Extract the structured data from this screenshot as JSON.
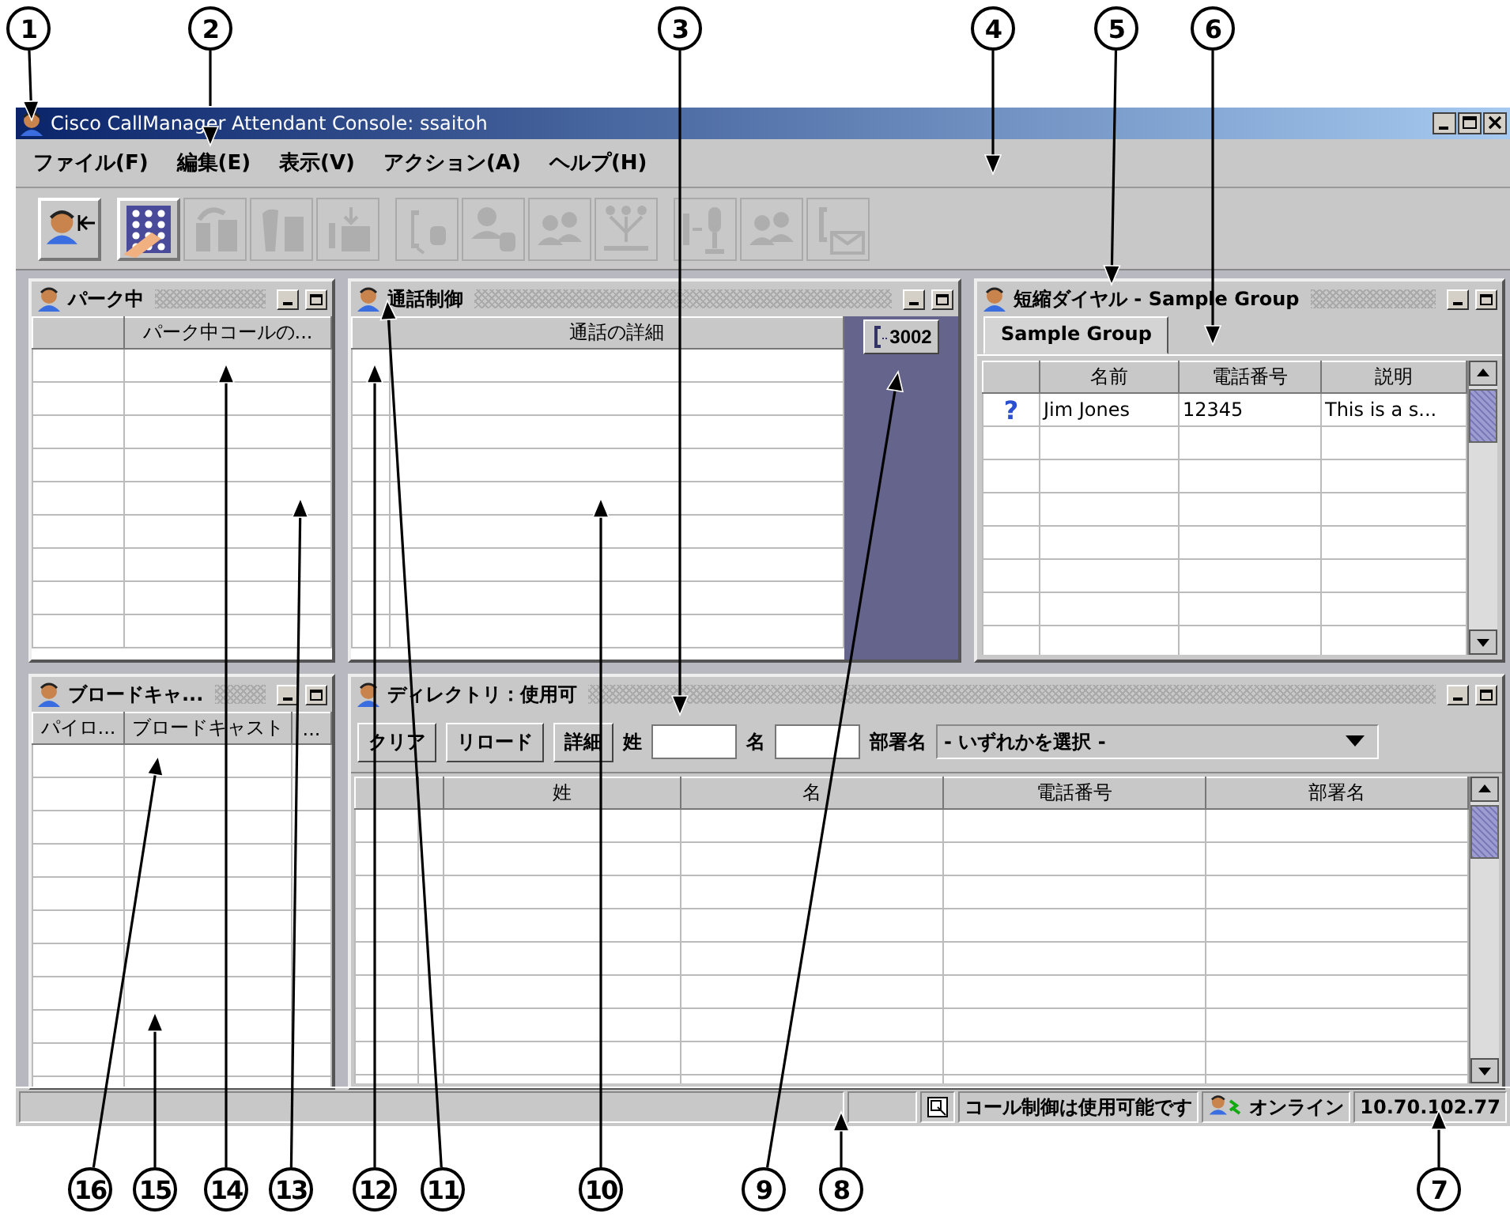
{
  "window": {
    "title": "Cisco CallManager Attendant Console: ssaitoh"
  },
  "menu": [
    {
      "label": "ファイル(F)"
    },
    {
      "label": "編集(E)"
    },
    {
      "label": "表示(V)"
    },
    {
      "label": "アクション(A)"
    },
    {
      "label": "ヘルプ(H)"
    }
  ],
  "toolbar": {
    "groups": [
      {
        "buttons": [
          {
            "kind": "login",
            "disabled": false
          }
        ]
      },
      {
        "buttons": [
          {
            "kind": "dialpad",
            "disabled": false
          },
          {
            "kind": "transfer",
            "disabled": true
          },
          {
            "kind": "hold",
            "disabled": true
          },
          {
            "kind": "park",
            "disabled": true
          }
        ]
      },
      {
        "buttons": [
          {
            "kind": "phone",
            "disabled": true
          },
          {
            "kind": "person",
            "disabled": true
          },
          {
            "kind": "people",
            "disabled": true
          },
          {
            "kind": "tree",
            "disabled": true
          }
        ]
      },
      {
        "buttons": [
          {
            "kind": "mic",
            "disabled": true
          },
          {
            "kind": "people",
            "disabled": true
          },
          {
            "kind": "mail",
            "disabled": true
          }
        ]
      }
    ]
  },
  "park_panel": {
    "title": "パーク中",
    "columns": [
      "",
      "パーク中コールの..."
    ]
  },
  "call_control_panel": {
    "title": "通話制御",
    "columns": [
      "",
      "通話の詳細"
    ],
    "line_button": "3002"
  },
  "speed_dial_panel": {
    "title": "短縮ダイヤル - Sample Group",
    "tabs": [
      {
        "label": "Sample Group",
        "selected": true
      }
    ],
    "columns": [
      "",
      "名前",
      "電話番号",
      "説明"
    ],
    "rows": [
      {
        "cells": [
          "?",
          "Jim Jones",
          "12345",
          "This is a s..."
        ]
      }
    ]
  },
  "broadcast_panel": {
    "title": "ブロードキャ...",
    "columns": [
      "パイロ...",
      "ブロードキャスト",
      "..."
    ]
  },
  "directory_panel": {
    "title": "ディレクトリ：使用可",
    "buttons": [
      "クリア",
      "リロード",
      "詳細"
    ],
    "fields": [
      {
        "label": "姓"
      },
      {
        "label": "名"
      }
    ],
    "dropdown": {
      "label": "部署名",
      "value": "- いずれかを選択 -"
    },
    "columns": [
      "",
      "",
      "姓",
      "名",
      "電話番号",
      "部署名"
    ]
  },
  "status_bar": {
    "message": "コール制御は使用可能です",
    "status": "オンライン",
    "address": "10.70.102.77"
  },
  "callouts": [
    {
      "label": "1"
    },
    {
      "label": "2"
    },
    {
      "label": "3"
    },
    {
      "label": "4"
    },
    {
      "label": "5"
    },
    {
      "label": "6"
    },
    {
      "label": "16"
    },
    {
      "label": "15"
    },
    {
      "label": "14"
    },
    {
      "label": "13"
    },
    {
      "label": "12"
    },
    {
      "label": "11"
    },
    {
      "label": "10"
    },
    {
      "label": "9"
    },
    {
      "label": "8"
    },
    {
      "label": "7"
    }
  ]
}
